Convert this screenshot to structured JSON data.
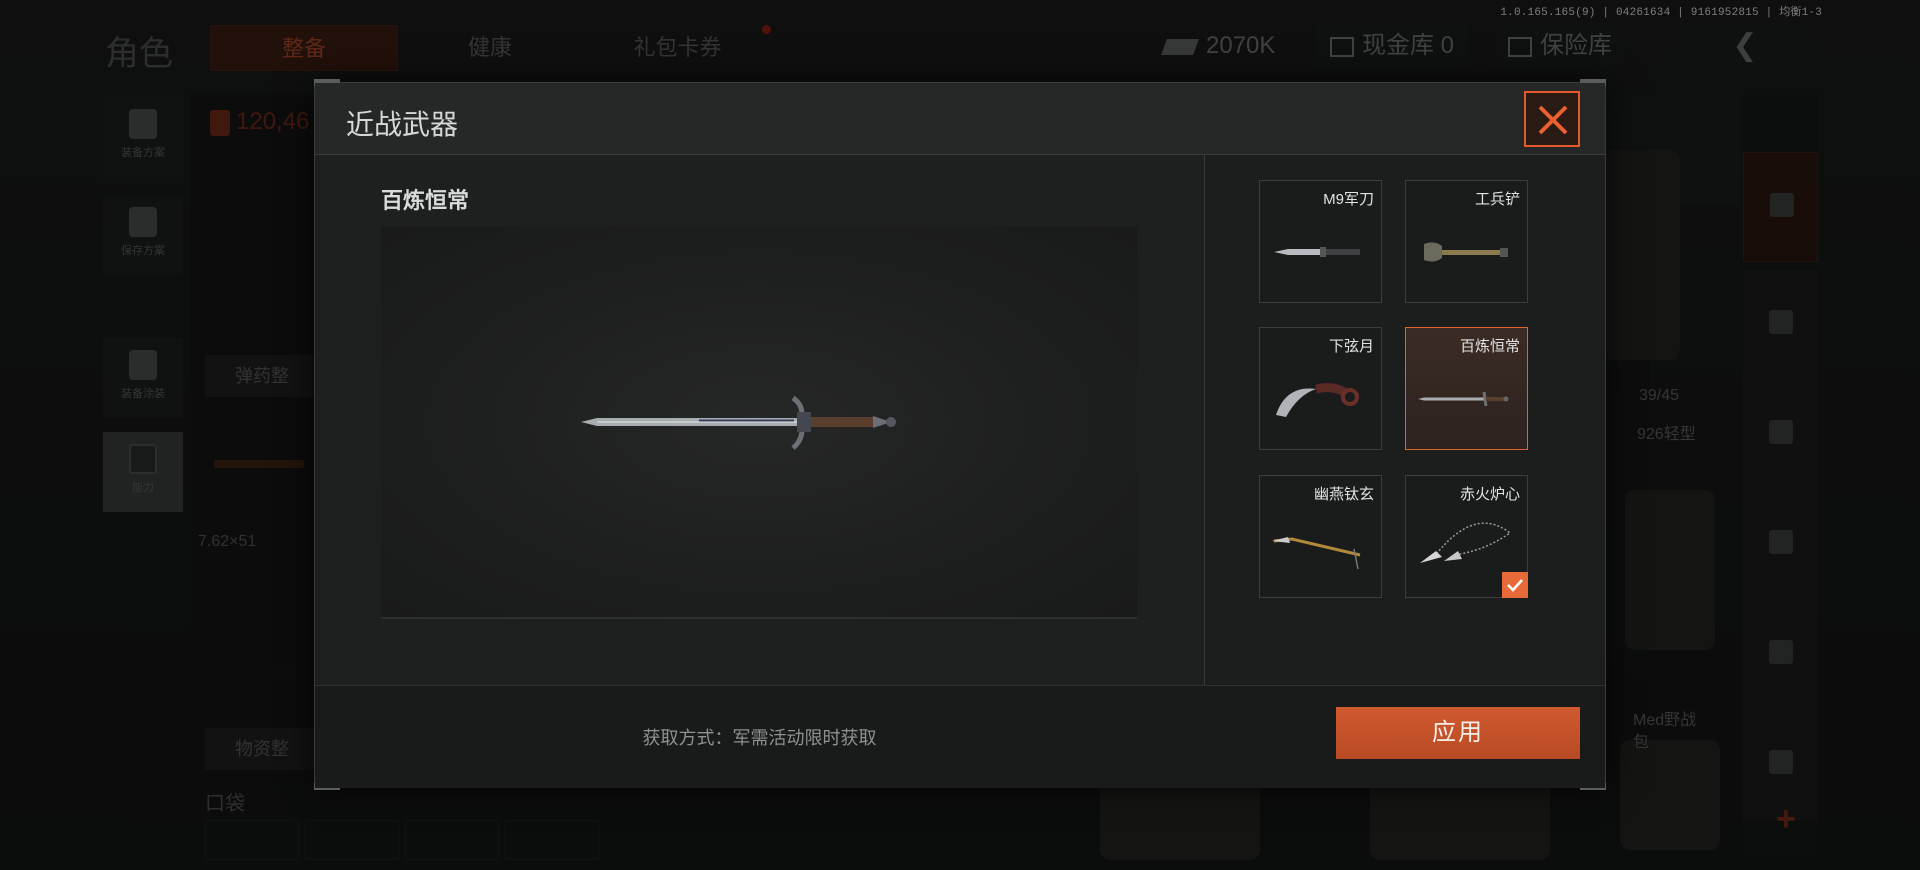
{
  "system": {
    "version": "1.0.165.165(9) | 04261634 | 9161952815 | 均衡1-3"
  },
  "background": {
    "title": "角色",
    "tabs": [
      {
        "label": "整备"
      },
      {
        "label": "健康"
      },
      {
        "label": "礼包卡券"
      }
    ],
    "money": "2070K",
    "cash_vault": "现金库 0",
    "safebox": "保险库",
    "sidebar": [
      {
        "label": "装备方案"
      },
      {
        "label": "保存方案"
      },
      {
        "label": "装备涂装"
      },
      {
        "label": "能力"
      }
    ],
    "weight_value": "120,46",
    "ammo_button": "弹药整",
    "supplies_button": "物资整",
    "ammo_caliber": "7.62×51",
    "pocket_label": "口袋",
    "capacity": "39/45",
    "model_label": "926轻型",
    "med_label": "Med野战\n包"
  },
  "modal": {
    "title": "近战武器",
    "preview_title": "百炼恒常",
    "items": [
      {
        "name": "M9军刀",
        "icon": "knife-icon",
        "selected": false,
        "owned": false
      },
      {
        "name": "工兵铲",
        "icon": "shovel-icon",
        "selected": false,
        "owned": false
      },
      {
        "name": "下弦月",
        "icon": "karambit-icon",
        "selected": false,
        "owned": false
      },
      {
        "name": "百炼恒常",
        "icon": "sword-icon",
        "selected": true,
        "owned": false
      },
      {
        "name": "幽燕钛玄",
        "icon": "spear-icon",
        "selected": false,
        "owned": false
      },
      {
        "name": "赤火炉心",
        "icon": "chain-dart-icon",
        "selected": false,
        "owned": true
      }
    ],
    "acquisition_text": "获取方式：军需活动限时获取",
    "apply_label": "应用"
  },
  "colors": {
    "accent": "#e0622f",
    "apply": "#c4522a",
    "panel": "#1e1f1f"
  }
}
